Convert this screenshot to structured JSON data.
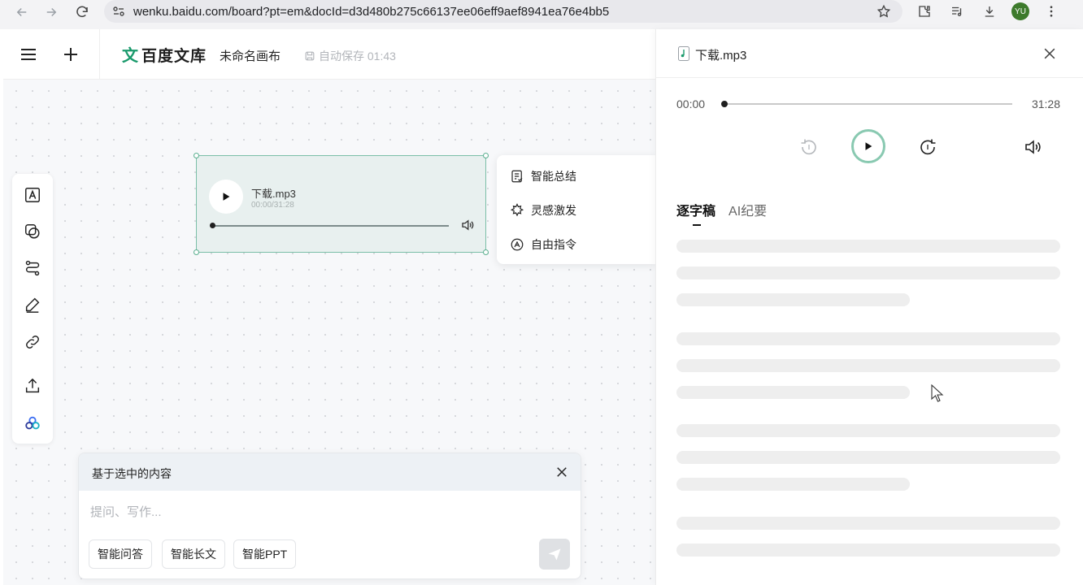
{
  "browser": {
    "url": "wenku.baidu.com/board?pt=em&docId=d3d480b275c66137ee06eff9aef8941ea76e4bb5",
    "avatar_initials": "YU"
  },
  "toolbar": {
    "logo_mark": "文",
    "logo_text": "百度文库",
    "doc_title": "未命名画布",
    "autosave": "自动保存 01:43"
  },
  "audio_card": {
    "file_name": "下载.mp3",
    "time": "00:00/31:28",
    "progress": 0
  },
  "ai_menu": {
    "items": [
      {
        "label": "智能总结",
        "icon": "summary-icon"
      },
      {
        "label": "灵感激发",
        "icon": "inspiration-icon"
      },
      {
        "label": "自由指令",
        "icon": "command-icon"
      }
    ]
  },
  "prompt": {
    "title": "基于选中的内容",
    "placeholder": "提问、写作...",
    "chips": [
      "智能问答",
      "智能长文",
      "智能PPT"
    ]
  },
  "side_panel": {
    "title": "下载.mp3",
    "current_time": "00:00",
    "total_time": "31:28",
    "tabs": [
      "逐字稿",
      "AI纪要"
    ],
    "active_tab": 0
  },
  "colors": {
    "accent": "#1a9a6c",
    "card_bg": "#e8f0ef",
    "selection": "#7bbfa8",
    "play_ring": "#89c9b1"
  }
}
